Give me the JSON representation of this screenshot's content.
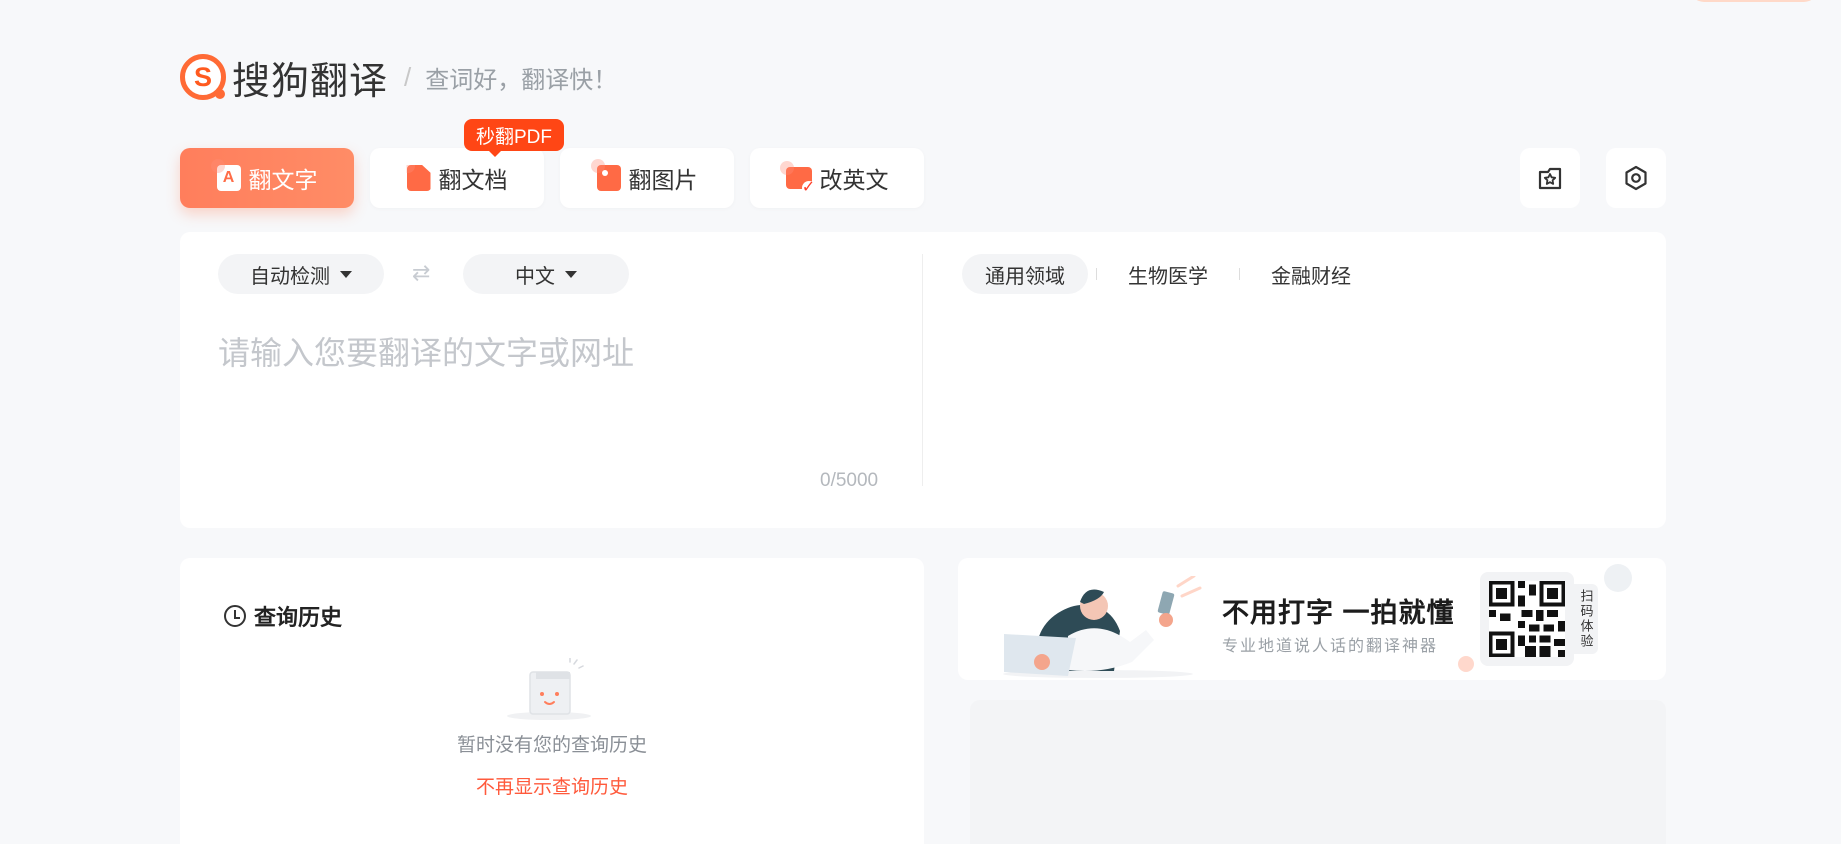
{
  "header": {
    "brand": "搜狗翻译",
    "slogan": "查词好，翻译快！"
  },
  "tabs": [
    {
      "label": "翻文字",
      "active": true,
      "icon": "text-translate-icon"
    },
    {
      "label": "翻文档",
      "active": false,
      "icon": "document-icon"
    },
    {
      "label": "翻图片",
      "active": false,
      "icon": "image-icon"
    },
    {
      "label": "改英文",
      "active": false,
      "icon": "english-correct-icon"
    }
  ],
  "pdf_badge": "秒翻PDF",
  "toolbar_icons": [
    "favorites-icon",
    "settings-icon"
  ],
  "source": {
    "language": "自动检测",
    "target_language": "中文",
    "placeholder": "请输入您要翻译的文字或网址",
    "char_count": "0/5000"
  },
  "domains": [
    {
      "label": "通用领域",
      "active": true
    },
    {
      "label": "生物医学",
      "active": false
    },
    {
      "label": "金融财经",
      "active": false
    }
  ],
  "history": {
    "title": "查询历史",
    "empty_text": "暂时没有您的查询历史",
    "hide_link": "不再显示查询历史"
  },
  "promo": {
    "headline": "不用打字 一拍就懂",
    "subtitle": "专业地道说人话的翻译神器",
    "scan_label": "扫码体验"
  },
  "colors": {
    "accent": "#ff7e5c",
    "badge": "#ff4615",
    "link": "#ff5a3c",
    "background": "#f7f8fa"
  }
}
